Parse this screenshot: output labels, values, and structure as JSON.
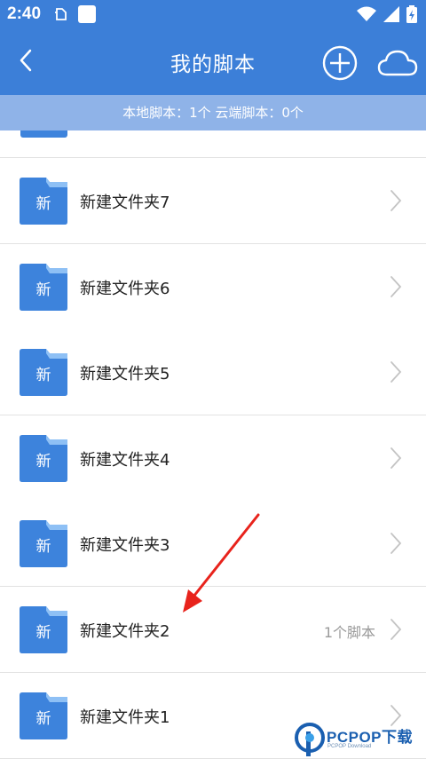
{
  "status_bar": {
    "time": "2:40"
  },
  "app_bar": {
    "title": "我的脚本"
  },
  "info_bar": {
    "text": "本地脚本：1个 云端脚本：0个"
  },
  "folders": [
    {
      "icon_char": "新",
      "name": "新建文件夹7",
      "count": ""
    },
    {
      "icon_char": "新",
      "name": "新建文件夹6",
      "count": ""
    },
    {
      "icon_char": "新",
      "name": "新建文件夹5",
      "count": ""
    },
    {
      "icon_char": "新",
      "name": "新建文件夹4",
      "count": ""
    },
    {
      "icon_char": "新",
      "name": "新建文件夹3",
      "count": ""
    },
    {
      "icon_char": "新",
      "name": "新建文件夹2",
      "count": "1个脚本"
    },
    {
      "icon_char": "新",
      "name": "新建文件夹1",
      "count": ""
    }
  ],
  "watermark": {
    "text": "PCPOP下载",
    "subtext": "PCPOP Download"
  },
  "colors": {
    "primary": "#3c7fd8",
    "info_bar": "#8fb3e8",
    "folder": "#3d83dc",
    "folder_tab": "#8ec0f5",
    "annotation_arrow": "#e8231c"
  },
  "icons": [
    "back-arrow-icon",
    "add-circle-icon",
    "cloud-icon",
    "folder-icon",
    "chevron-right-icon",
    "wifi-icon",
    "signal-icon",
    "battery-icon"
  ]
}
